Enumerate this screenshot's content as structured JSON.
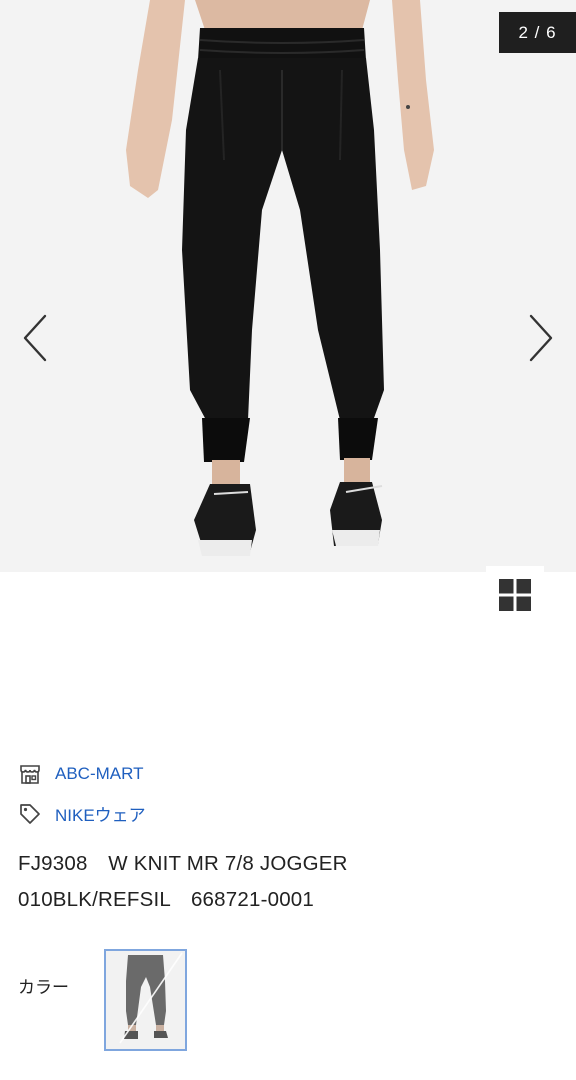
{
  "gallery": {
    "counter": "2 / 6",
    "image_alt": "W KNIT MR 7/8 JOGGER"
  },
  "icons": {
    "prev": "chevron-left-icon",
    "next": "chevron-right-icon",
    "grid": "grid-view-icon",
    "shop": "storefront-icon",
    "tag": "price-tag-icon"
  },
  "shop": {
    "name": "ABC-MART"
  },
  "category": {
    "name": "NIKEウェア"
  },
  "product": {
    "line1": "FJ9308　W KNIT MR 7/8 JOGGER",
    "line2": "010BLK/REFSIL　668721-0001"
  },
  "colors": {
    "label": "カラー"
  },
  "theme": {
    "link_color": "#1f5fbf",
    "swatch_border": "#7fa6de",
    "counter_bg": "#1f1f1f"
  }
}
